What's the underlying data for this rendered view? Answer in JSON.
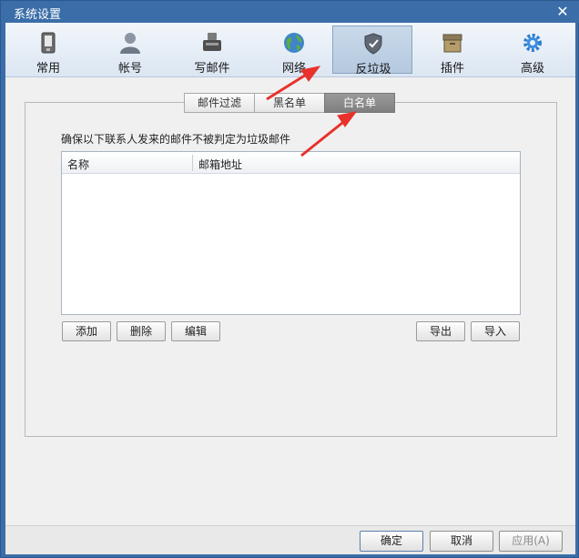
{
  "window": {
    "title": "系统设置",
    "close_glyph": "✕"
  },
  "toolbar": {
    "items": [
      {
        "label": "常用",
        "icon": "phone-icon"
      },
      {
        "label": "帐号",
        "icon": "user-icon"
      },
      {
        "label": "写邮件",
        "icon": "compose-icon"
      },
      {
        "label": "网络",
        "icon": "globe-icon"
      },
      {
        "label": "反垃圾",
        "icon": "shield-icon",
        "active": true
      },
      {
        "label": "插件",
        "icon": "box-icon"
      },
      {
        "label": "高级",
        "icon": "gear-icon"
      }
    ]
  },
  "tabs": [
    {
      "label": "邮件过滤"
    },
    {
      "label": "黑名单"
    },
    {
      "label": "白名单",
      "active": true
    }
  ],
  "whitelist": {
    "description": "确保以下联系人发来的邮件不被判定为垃圾邮件",
    "columns": [
      "名称",
      "邮箱地址"
    ],
    "rows": []
  },
  "actions": {
    "add": "添加",
    "delete": "删除",
    "edit": "编辑",
    "export": "导出",
    "import": "导入"
  },
  "footer": {
    "ok": "确定",
    "cancel": "取消",
    "apply": "应用(A)"
  },
  "colors": {
    "titlebar": "#3b6ea8",
    "annotation_arrow": "#e8322b",
    "active_tab": "#8c8c8c"
  }
}
